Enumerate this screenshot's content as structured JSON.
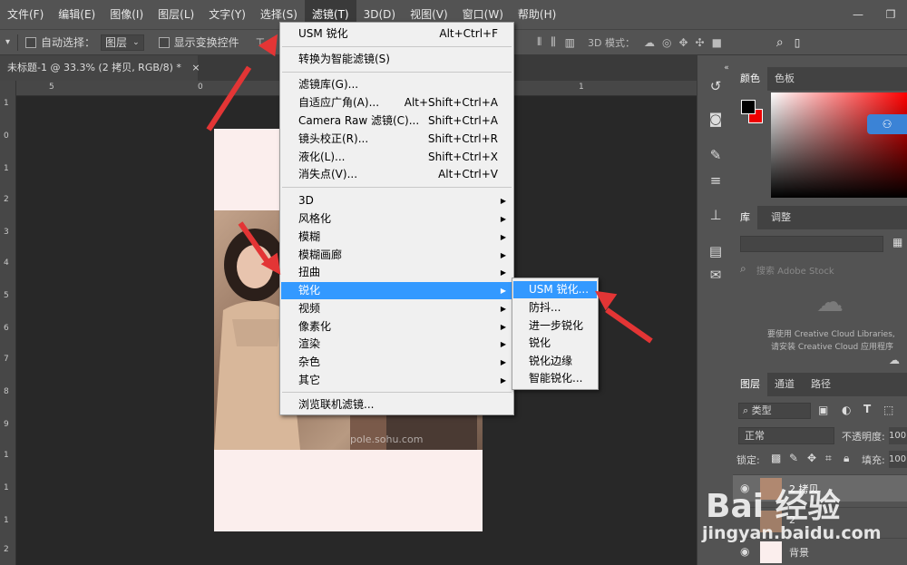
{
  "menubar": {
    "items": [
      "文件(F)",
      "编辑(E)",
      "图像(I)",
      "图层(L)",
      "文字(Y)",
      "选择(S)",
      "滤镜(T)",
      "3D(D)",
      "视图(V)",
      "窗口(W)",
      "帮助(H)"
    ],
    "active_index": 6
  },
  "options_bar": {
    "auto_select_label": "自动选择：",
    "auto_select_value": "图层",
    "show_transform_label": "显示变换控件",
    "mode_3d_label": "3D 模式："
  },
  "document_tab": {
    "title": "未标题-1 @ 33.3% (2 拷贝, RGB/8) *",
    "close": "×"
  },
  "ruler": {
    "top_ticks": [
      "5",
      "0",
      "5",
      "1"
    ],
    "left_ticks": [
      "1",
      "0",
      "1",
      "2",
      "3",
      "4",
      "5",
      "6",
      "7",
      "8",
      "9",
      "1",
      "1",
      "1",
      "2"
    ]
  },
  "filter_menu": {
    "last_filter": {
      "label": "USM 锐化",
      "shortcut": "Alt+Ctrl+F"
    },
    "convert_smart": "转换为智能滤镜(S)",
    "group_gallery": [
      {
        "label": "滤镜库(G)...",
        "shortcut": ""
      },
      {
        "label": "自适应广角(A)...",
        "shortcut": "Alt+Shift+Ctrl+A"
      },
      {
        "label": "Camera Raw 滤镜(C)...",
        "shortcut": "Shift+Ctrl+A"
      },
      {
        "label": "镜头校正(R)...",
        "shortcut": "Shift+Ctrl+R"
      },
      {
        "label": "液化(L)...",
        "shortcut": "Shift+Ctrl+X"
      },
      {
        "label": "消失点(V)...",
        "shortcut": "Alt+Ctrl+V"
      }
    ],
    "submenus": [
      "3D",
      "风格化",
      "模糊",
      "模糊画廊",
      "扭曲",
      "锐化",
      "视频",
      "像素化",
      "渲染",
      "杂色",
      "其它"
    ],
    "highlight_index": 5,
    "browse_online": "浏览联机滤镜..."
  },
  "sharpen_submenu": {
    "items": [
      "USM 锐化...",
      "防抖...",
      "进一步锐化",
      "锐化",
      "锐化边缘",
      "智能锐化..."
    ],
    "highlight_index": 0
  },
  "right_panel": {
    "color_tabs": [
      "颜色",
      "色板"
    ],
    "library_tabs": [
      "库",
      "调整"
    ],
    "library_search_placeholder": "搜索 Adobe Stock",
    "cc_message_line1": "要使用 Creative Cloud Libraries,",
    "cc_message_line2": "请安装 Creative Cloud 应用程序",
    "layer_tabs": [
      "图层",
      "通道",
      "路径"
    ],
    "filter_kind": "类型",
    "blend_mode": "正常",
    "opacity_label": "不透明度:",
    "opacity_value": "100",
    "lock_label": "锁定:",
    "fill_label": "填充:",
    "fill_value": "100",
    "layers": [
      {
        "name": "2 拷贝"
      },
      {
        "name": "2"
      },
      {
        "name": "背景"
      }
    ]
  },
  "watermark": {
    "brand": "Bai 经验",
    "url": "jingyan.baidu.com"
  },
  "photo_watermark": "pole.sohu.com",
  "colors": {
    "highlight": "#3399ff",
    "arrow": "#e33535",
    "menubar": "#535353",
    "doc_bg": "#fbeeed"
  }
}
